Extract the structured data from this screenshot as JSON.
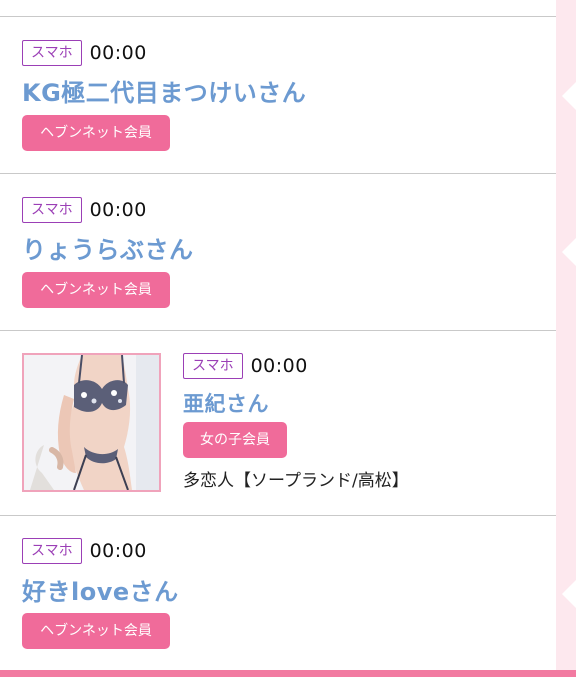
{
  "entries": [
    {
      "device": "スマホ",
      "time": "00:00",
      "name": "KG極二代目まつけいさん",
      "member": "ヘブンネット会員"
    },
    {
      "device": "スマホ",
      "time": "00:00",
      "name": "りょうらぶさん",
      "member": "ヘブンネット会員"
    },
    {
      "device": "スマホ",
      "time": "00:00",
      "name": "亜紀さん",
      "member": "女の子会員",
      "shop": "多恋人【ソープランド/高松】",
      "has_photo": true
    },
    {
      "device": "スマホ",
      "time": "00:00",
      "name": "好きloveさん",
      "member": "ヘブンネット会員"
    }
  ],
  "colors": {
    "name": "#6c9ad1",
    "device_badge": "#9b3fb6",
    "member_badge": "#f06b9a",
    "side_strip": "#fde8ee",
    "bottom_bar": "#f27aa1"
  }
}
